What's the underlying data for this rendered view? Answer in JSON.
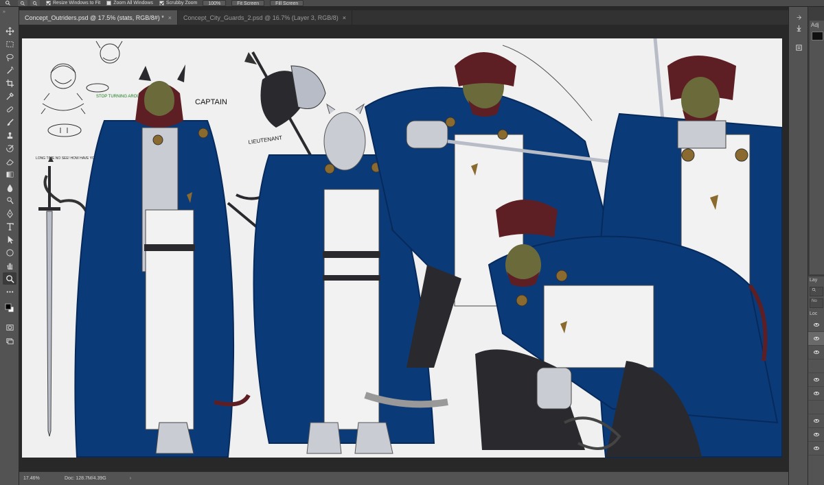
{
  "options_bar": {
    "resize_windows_to_fit": "Resize Windows to Fit",
    "resize_windows_checked": true,
    "zoom_all_windows": "Zoom All Windows",
    "zoom_all_checked": false,
    "scrubby_zoom": "Scrubby Zoom",
    "scrubby_zoom_checked": true,
    "zoom_percent_button": "100%",
    "fit_screen_button": "Fit Screen",
    "fill_screen_button": "Fill Screen"
  },
  "tabs": [
    {
      "label": "Concept_Outriders.psd @ 17.5% (stats, RGB/8#) *",
      "active": true
    },
    {
      "label": "Concept_City_Guards_2.psd @ 16.7% (Layer 3, RGB/8)",
      "active": false
    }
  ],
  "tab_close_glyph": "×",
  "canvas": {
    "annotation_captain": "CAPTAIN",
    "annotation_lieutenant": "LIEUTENANT",
    "note_stop_turning": "STOP TURNING AROUND!",
    "note_long_time": "LONG TIME NO SEE! HOW HAVE YOU BEEN THE FAMILY BEEN?",
    "colors": {
      "cloak_blue": "#0b3a78",
      "cloak_blue_dark": "#062a5c",
      "hair_maroon": "#5e1f24",
      "skin_olive": "#6b6a3a",
      "armor_grey": "#c9ccd3",
      "tunic_white": "#f2f2f2",
      "dark_cloth": "#2a2a2e",
      "gold_emblem": "#8a6a2e",
      "canvas_bg": "#f0f0f0"
    }
  },
  "status": {
    "zoom": "17.46%",
    "doc": "Doc: 128.7M/4.39G",
    "arrow": "›"
  },
  "right_panel": {
    "adjustments_label": "Adj",
    "layers_label": "Lay",
    "layer_filter_label": "No",
    "layer_lock_label": "Loc"
  }
}
